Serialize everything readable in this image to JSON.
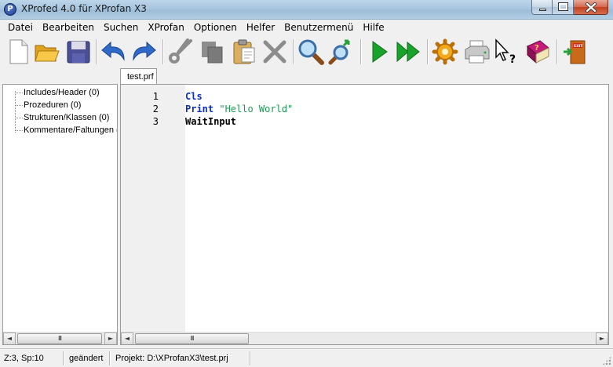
{
  "window": {
    "title": "XProfed 4.0 für XProfan X3",
    "app_icon_letter": "P"
  },
  "menu": [
    "Datei",
    "Bearbeiten",
    "Suchen",
    "XProfan",
    "Optionen",
    "Helfer",
    "Benutzermenü",
    "Hilfe"
  ],
  "toolbar": {
    "buttons": [
      "new-file",
      "open-file",
      "save",
      "undo",
      "redo",
      "cut",
      "copy",
      "paste",
      "delete",
      "search",
      "replace",
      "run",
      "run-fast",
      "settings",
      "print",
      "context-help",
      "help-book",
      "exit"
    ],
    "exit_label": "EXIT"
  },
  "tree": {
    "items": [
      "Includes/Header (0)",
      "Prozeduren (0)",
      "Strukturen/Klassen (0)",
      "Kommentare/Faltungen (0)"
    ]
  },
  "tabs": [
    "test.prf"
  ],
  "editor": {
    "lines": [
      {
        "num": "1",
        "tokens": [
          {
            "t": "Cls",
            "c": "kw"
          }
        ]
      },
      {
        "num": "2",
        "tokens": [
          {
            "t": "Print ",
            "c": "kw"
          },
          {
            "t": "\"Hello World\"",
            "c": "str"
          }
        ]
      },
      {
        "num": "3",
        "tokens": [
          {
            "t": "WaitInput",
            "c": "plain"
          }
        ]
      }
    ]
  },
  "scrollbars": {
    "left_arrow": "◄",
    "right_arrow": "►",
    "thumb_grip": "III"
  },
  "status": {
    "position": "Z:3, Sp:10",
    "state": "geändert",
    "project": "Projekt: D:\\XProfanX3\\test.prj"
  },
  "colors": {
    "keyword": "#0c2fbf",
    "string": "#1e9a52",
    "run_button": "#1aa32a"
  }
}
